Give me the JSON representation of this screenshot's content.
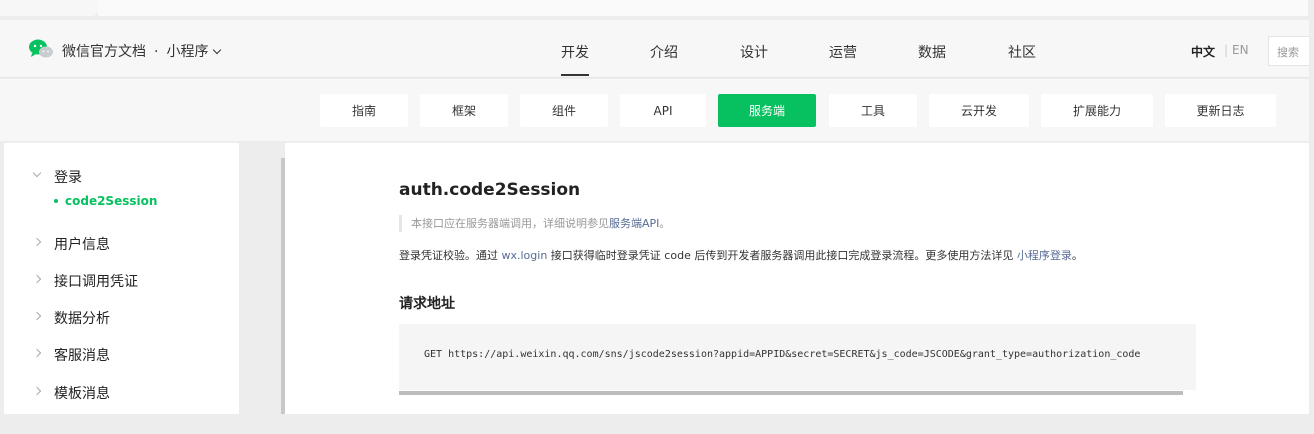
{
  "brand": {
    "site_name": "微信官方文档",
    "dot": "·",
    "section": "小程序"
  },
  "nav": {
    "items": [
      {
        "label": "开发",
        "active": true
      },
      {
        "label": "介绍"
      },
      {
        "label": "设计"
      },
      {
        "label": "运营"
      },
      {
        "label": "数据"
      },
      {
        "label": "社区"
      }
    ]
  },
  "lang": {
    "zh": "中文",
    "sep": "|",
    "en": "EN"
  },
  "search": {
    "placeholder": "搜索"
  },
  "subnav": {
    "items": [
      {
        "label": "指南"
      },
      {
        "label": "框架"
      },
      {
        "label": "组件"
      },
      {
        "label": "API"
      },
      {
        "label": "服务端",
        "active": true
      },
      {
        "label": "工具"
      },
      {
        "label": "云开发"
      },
      {
        "label": "扩展能力"
      },
      {
        "label": "更新日志"
      }
    ]
  },
  "sidebar": {
    "items": [
      {
        "label": "登录",
        "expanded": true
      },
      {
        "label": "用户信息"
      },
      {
        "label": "接口调用凭证"
      },
      {
        "label": "数据分析"
      },
      {
        "label": "客服消息"
      },
      {
        "label": "模板消息"
      }
    ],
    "sub_item": "code2Session"
  },
  "content": {
    "title": "auth.code2Session",
    "note_prefix": "本接口应在服务器端调用，详细说明参见",
    "note_link": "服务端API",
    "note_suffix": "。",
    "desc_1": "登录凭证校验。通过 ",
    "desc_link_1": "wx.login",
    "desc_2": " 接口获得临时登录凭证 code 后传到开发者服务器调用此接口完成登录流程。更多使用方法详见 ",
    "desc_link_2": "小程序登录",
    "desc_3": "。",
    "request_heading": "请求地址",
    "code": "GET https://api.weixin.qq.com/sns/jscode2session?appid=APPID&secret=SECRET&js_code=JSCODE&grant_type=authorization_code"
  },
  "colors": {
    "accent": "#07c160",
    "link": "#576b95"
  }
}
